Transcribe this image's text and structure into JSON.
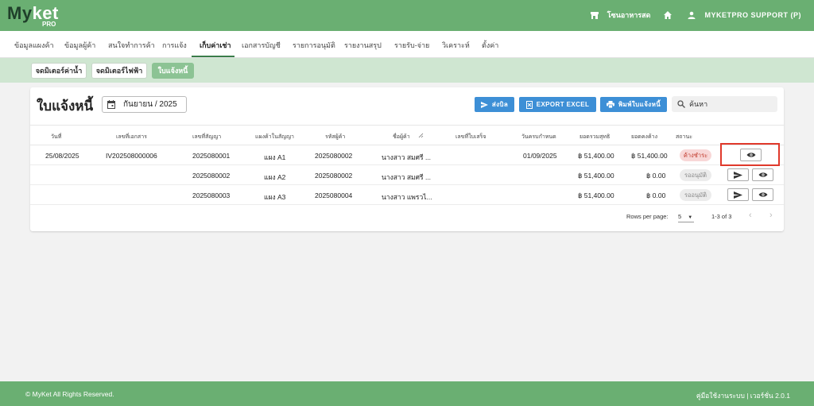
{
  "brand": {
    "name_part1": "My",
    "name_part2": "ket",
    "sub": "PRO"
  },
  "topbar": {
    "store_label": "โซนอาหารสด",
    "user_label": "MYKETPRO SUPPORT (P)"
  },
  "nav": [
    "ข้อมูลแผงค้า",
    "ข้อมูลผู้ค้า",
    "สนใจทำการค้า",
    "การแจ้ง",
    "เก็บค่าเช่า",
    "เอกสารบัญชี",
    "รายการอนุมัติ",
    "รายงานสรุป",
    "รายรับ-จ่าย",
    "วิเคราะห์",
    "ตั้งค่า"
  ],
  "subtabs": [
    "จดมิเตอร์ค่าน้ำ",
    "จดมิเตอร์ไฟฟ้า",
    "ใบแจ้งหนี้"
  ],
  "page": {
    "title": "ใบแจ้งหนี้",
    "month": "กันยายน / 2025",
    "send_label": "ส่งบิล",
    "export_label": "EXPORT EXCEL",
    "print_label": "พิมพ์ใบแจ้งหนี้",
    "search_placeholder": "ค้นหา"
  },
  "table": {
    "headers": [
      "วันที่",
      "เลขที่เอกสาร",
      "เลขที่สัญญา",
      "แผงค้าในสัญญา",
      "รหัสผู้ค้า",
      "ชื่อผู้ค้า",
      "เลขที่ใบเสร็จ",
      "วันครบกำหนด",
      "ยอดรวมสุทธิ",
      "ยอดคงค้าง",
      "สถานะ"
    ],
    "rows": [
      {
        "date": "25/08/2025",
        "doc_no": "IV202508000006",
        "contract": "2025080001",
        "stall": "แผง A1",
        "vendor_id": "2025080002",
        "vendor_name": "นางสาว สมศรี ...",
        "receipt": "",
        "due": "01/09/2025",
        "total": "฿ 51,400.00",
        "outstanding": "฿ 51,400.00",
        "status": "ค้างชำระ",
        "status_kind": "unpaid",
        "has_send": false
      },
      {
        "date": "",
        "doc_no": "",
        "contract": "2025080002",
        "stall": "แผง A2",
        "vendor_id": "2025080002",
        "vendor_name": "นางสาว สมศรี ...",
        "receipt": "",
        "due": "",
        "total": "฿ 51,400.00",
        "outstanding": "฿ 0.00",
        "status": "รออนุมัติ",
        "status_kind": "pending",
        "has_send": true
      },
      {
        "date": "",
        "doc_no": "",
        "contract": "2025080003",
        "stall": "แผง A3",
        "vendor_id": "2025080004",
        "vendor_name": "นางสาว แพรวไ...",
        "receipt": "",
        "due": "",
        "total": "฿ 51,400.00",
        "outstanding": "฿ 0.00",
        "status": "รออนุมัติ",
        "status_kind": "pending",
        "has_send": true
      }
    ]
  },
  "pagination": {
    "rows_label": "Rows per page:",
    "rows_value": "5",
    "range": "1-3 of 3"
  },
  "footer": {
    "copyright": "© MyKet All Rights Reserved.",
    "right": "คู่มือใช้งานระบบ | เวอร์ชั่น 2.0.1"
  },
  "colors": {
    "primary": "#6aaf72",
    "subbar": "#cfe6d1",
    "button_blue": "#3d8fd6",
    "highlight": "#e0392b",
    "status_unpaid": "#c0392b"
  }
}
